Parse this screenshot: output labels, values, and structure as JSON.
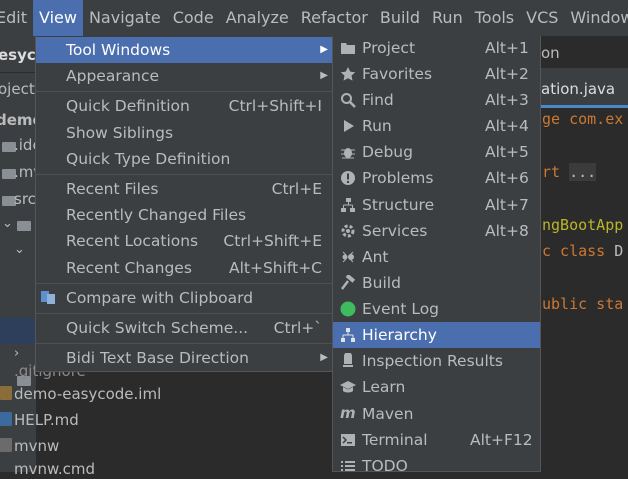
{
  "menubar": {
    "items": [
      {
        "label": "Edit"
      },
      {
        "label": "View"
      },
      {
        "label": "Navigate"
      },
      {
        "label": "Code"
      },
      {
        "label": "Analyze"
      },
      {
        "label": "Refactor"
      },
      {
        "label": "Build"
      },
      {
        "label": "Run"
      },
      {
        "label": "Tools"
      },
      {
        "label": "VCS"
      },
      {
        "label": "Window"
      }
    ]
  },
  "background": {
    "project_label": "esyco",
    "project_tab": "oject",
    "demo_label": "demo",
    "tree": [
      ".ide",
      ".mv",
      "src"
    ],
    "files": [
      ".gitignore",
      "demo-easycode.iml",
      "HELP.md",
      "mvnw",
      "mvnw.cmd"
    ],
    "editor_tab_1": "on",
    "editor_tab_2": "ation.java",
    "code_lines": [
      "ge com.ex",
      "rt ...",
      "ngBootApp",
      "c class D",
      "ublic sta"
    ]
  },
  "view_menu": {
    "items": [
      {
        "label": "Tool Windows",
        "shortcut": ""
      },
      {
        "label": "Appearance",
        "shortcut": ""
      },
      {
        "label": "Quick Definition",
        "shortcut": "Ctrl+Shift+I"
      },
      {
        "label": "Show Siblings",
        "shortcut": ""
      },
      {
        "label": "Quick Type Definition",
        "shortcut": ""
      },
      {
        "label": "Recent Files",
        "shortcut": "Ctrl+E"
      },
      {
        "label": "Recently Changed Files",
        "shortcut": ""
      },
      {
        "label": "Recent Locations",
        "shortcut": "Ctrl+Shift+E"
      },
      {
        "label": "Recent Changes",
        "shortcut": "Alt+Shift+C"
      },
      {
        "label": "Compare with Clipboard",
        "shortcut": ""
      },
      {
        "label": "Quick Switch Scheme...",
        "shortcut": "Ctrl+`"
      },
      {
        "label": "Bidi Text Base Direction",
        "shortcut": ""
      }
    ]
  },
  "tool_windows_menu": {
    "items": [
      {
        "label": "Project",
        "shortcut": "Alt+1",
        "icon": "folder-icon"
      },
      {
        "label": "Favorites",
        "shortcut": "Alt+2",
        "icon": "star-icon"
      },
      {
        "label": "Find",
        "shortcut": "Alt+3",
        "icon": "search-icon"
      },
      {
        "label": "Run",
        "shortcut": "Alt+4",
        "icon": "play-icon"
      },
      {
        "label": "Debug",
        "shortcut": "Alt+5",
        "icon": "bug-icon"
      },
      {
        "label": "Problems",
        "shortcut": "Alt+6",
        "icon": "warning-icon"
      },
      {
        "label": "Structure",
        "shortcut": "Alt+7",
        "icon": "structure-icon"
      },
      {
        "label": "Services",
        "shortcut": "Alt+8",
        "icon": "services-icon"
      },
      {
        "label": "Ant",
        "shortcut": "",
        "icon": "ant-icon"
      },
      {
        "label": "Build",
        "shortcut": "",
        "icon": "hammer-icon"
      },
      {
        "label": "Event Log",
        "shortcut": "",
        "icon": "event-log-icon"
      },
      {
        "label": "Hierarchy",
        "shortcut": "",
        "icon": "hierarchy-icon"
      },
      {
        "label": "Inspection Results",
        "shortcut": "",
        "icon": "inspection-icon"
      },
      {
        "label": "Learn",
        "shortcut": "",
        "icon": "learn-icon"
      },
      {
        "label": "Maven",
        "shortcut": "",
        "icon": "maven-icon"
      },
      {
        "label": "Terminal",
        "shortcut": "Alt+F12",
        "icon": "terminal-icon"
      },
      {
        "label": "TODO",
        "shortcut": "",
        "icon": "todo-icon"
      }
    ]
  },
  "colors": {
    "menu_bg": "#3c3f41",
    "highlight": "#4b6eaf",
    "event_log_green": "#3dbb5e",
    "code_orange": "#cc7832"
  }
}
